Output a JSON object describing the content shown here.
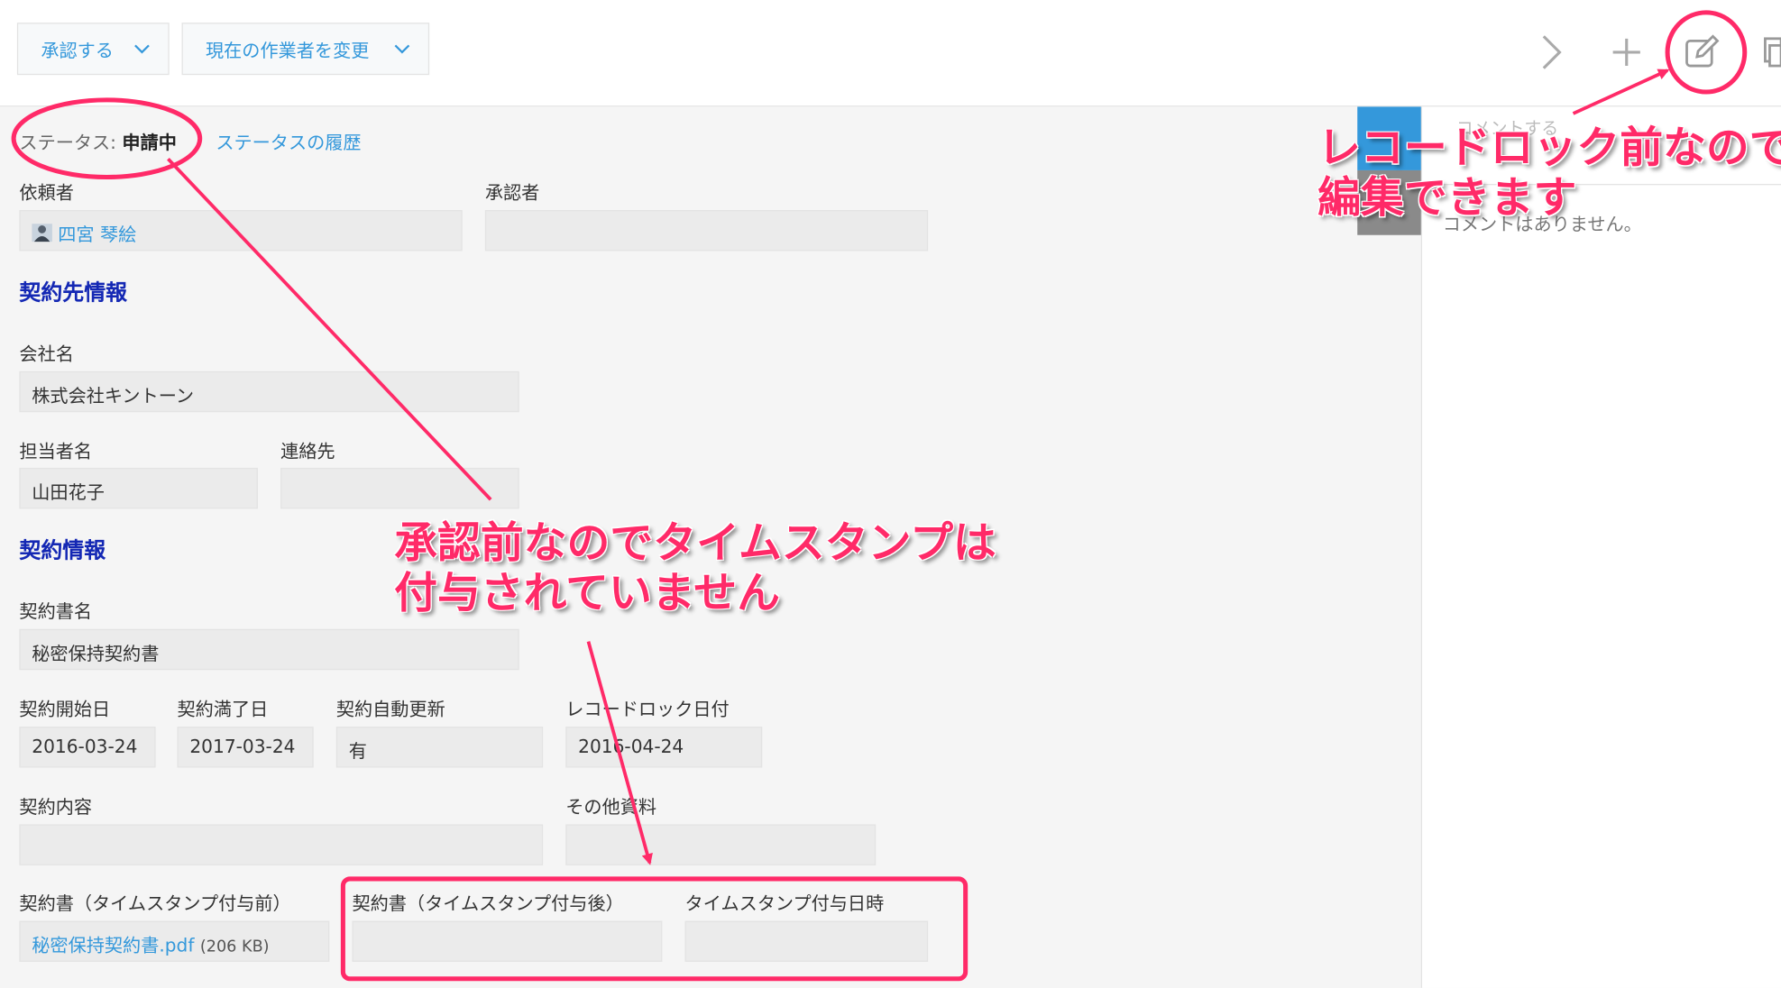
{
  "toolbar": {
    "approve_label": "承認する",
    "change_assignee_label": "現在の作業者を変更"
  },
  "status": {
    "label": "ステータス:",
    "value": "申請中",
    "history_link": "ステータスの履歴"
  },
  "fields": {
    "requester_label": "依頼者",
    "requester_value": "四宮 琴絵",
    "approver_label": "承認者",
    "approver_value": "",
    "section1_title": "契約先情報",
    "company_label": "会社名",
    "company_value": "株式会社キントーン",
    "contact_person_label": "担当者名",
    "contact_person_value": "山田花子",
    "contact_info_label": "連絡先",
    "contact_info_value": "",
    "section2_title": "契約情報",
    "contract_name_label": "契約書名",
    "contract_name_value": "秘密保持契約書",
    "start_date_label": "契約開始日",
    "start_date_value": "2016-03-24",
    "end_date_label": "契約満了日",
    "end_date_value": "2017-03-24",
    "auto_renew_label": "契約自動更新",
    "auto_renew_value": "有",
    "lock_date_label": "レコードロック日付",
    "lock_date_value": "2016-04-24",
    "content_label": "契約内容",
    "content_value": "",
    "other_docs_label": "その他資料",
    "other_docs_value": "",
    "doc_before_label": "契約書（タイムスタンプ付与前）",
    "doc_before_file": "秘密保持契約書.pdf",
    "doc_before_size": "(206 KB)",
    "doc_after_label": "契約書（タイムスタンプ付与後）",
    "doc_after_value": "",
    "timestamp_label": "タイムスタンプ付与日時",
    "timestamp_value": ""
  },
  "sidebar": {
    "comment_prompt": "コメントする",
    "no_comments": "コメントはありません。"
  },
  "annotations": {
    "edit_note_line1": "レコードロック前なので",
    "edit_note_line2": "編集できます",
    "timestamp_note_line1": "承認前なのでタイムスタンプは",
    "timestamp_note_line2": "付与されていません"
  },
  "colors": {
    "accent": "#3498db",
    "section_title": "#1428b4",
    "annotation": "#ff2a68"
  },
  "icons": [
    "chevron-down-icon",
    "chevron-right-icon",
    "plus-icon",
    "edit-icon",
    "copy-icon",
    "user-avatar-icon"
  ]
}
